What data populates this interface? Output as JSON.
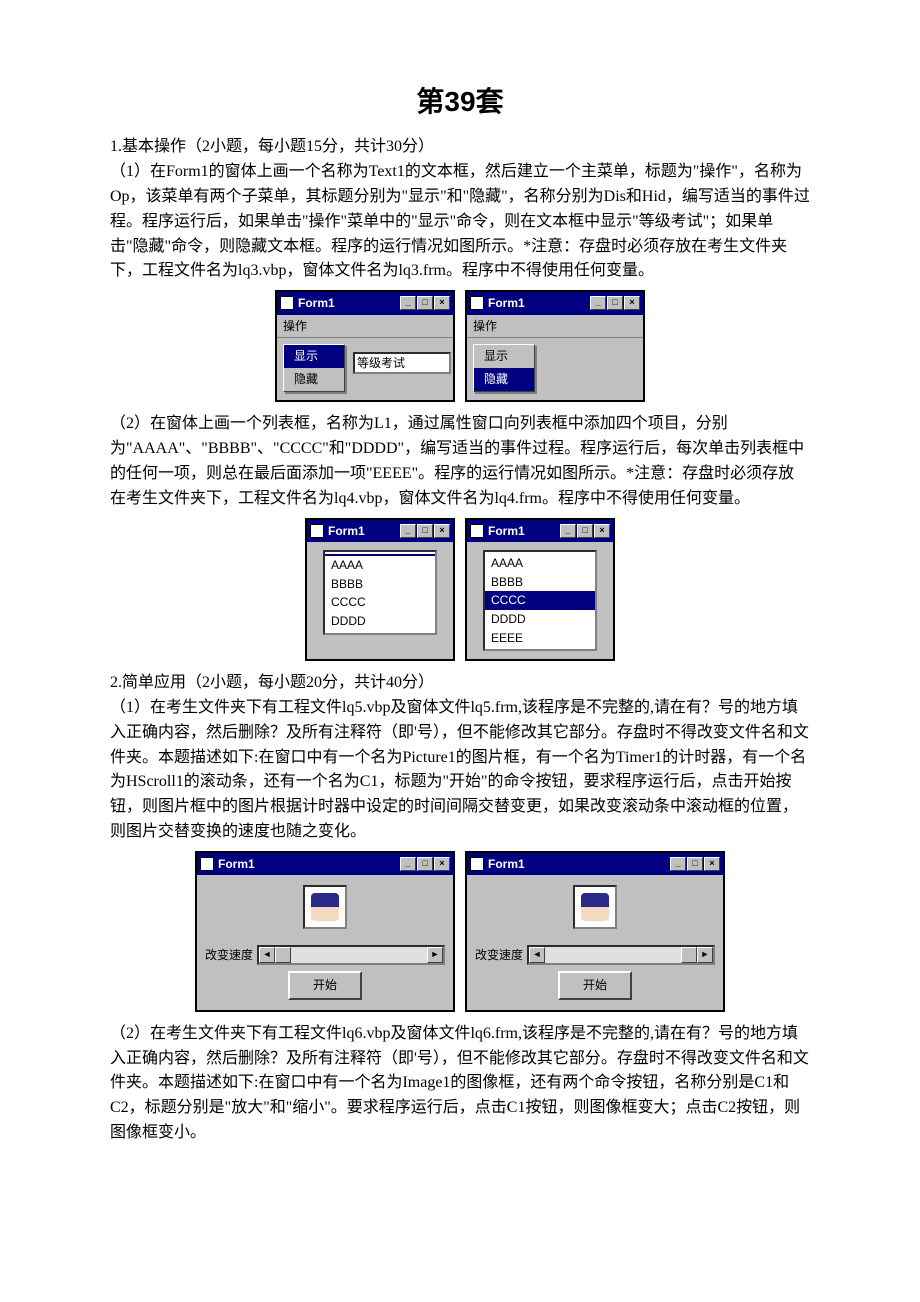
{
  "title": "第39套",
  "s1_heading": "1.基本操作（2小题，每小题15分，共计30分）",
  "s1_q1": "（1）在Form1的窗体上画一个名称为Text1的文本框，然后建立一个主菜单，标题为\"操作\"，名称为Op，该菜单有两个子菜单，其标题分别为\"显示\"和\"隐藏\"，名称分别为Dis和Hid，编写适当的事件过程。程序运行后，如果单击\"操作\"菜单中的\"显示\"命令，则在文本框中显示\"等级考试\"；如果单击\"隐藏\"命令，则隐藏文本框。程序的运行情况如图所示。*注意：存盘时必须存放在考生文件夹下，工程文件名为lq3.vbp，窗体文件名为lq3.frm。程序中不得使用任何变量。",
  "s1_q2": "（2）在窗体上画一个列表框，名称为L1，通过属性窗口向列表框中添加四个项目，分别为\"AAAA\"、\"BBBB\"、\"CCCC\"和\"DDDD\"，编写适当的事件过程。程序运行后，每次单击列表框中的任何一项，则总在最后面添加一项\"EEEE\"。程序的运行情况如图所示。*注意：存盘时必须存放在考生文件夹下，工程文件名为lq4.vbp，窗体文件名为lq4.frm。程序中不得使用任何变量。",
  "s2_heading": "2.简单应用（2小题，每小题20分，共计40分）",
  "s2_q1": "（1）在考生文件夹下有工程文件lq5.vbp及窗体文件lq5.frm,该程序是不完整的,请在有？号的地方填入正确内容，然后删除？及所有注释符（即'号），但不能修改其它部分。存盘时不得改变文件名和文件夹。本题描述如下:在窗口中有一个名为Picture1的图片框，有一个名为Timer1的计时器，有一个名为HScroll1的滚动条，还有一个名为C1，标题为\"开始\"的命令按钮，要求程序运行后，点击开始按钮，则图片框中的图片根据计时器中设定的时间间隔交替变更，如果改变滚动条中滚动框的位置，则图片交替变换的速度也随之变化。",
  "s2_q2": "（2）在考生文件夹下有工程文件lq6.vbp及窗体文件lq6.frm,该程序是不完整的,请在有？号的地方填入正确内容，然后删除？及所有注释符（即'号），但不能修改其它部分。存盘时不得改变文件名和文件夹。本题描述如下:在窗口中有一个名为Image1的图像框，还有两个命令按钮，名称分别是C1和C2，标题分别是\"放大\"和\"缩小\"。要求程序运行后，点击C1按钮，则图像框变大；点击C2按钮，则图像框变小。",
  "form_title": "Form1",
  "menu_op": "操作",
  "menu_show": "显示",
  "menu_hide": "隐藏",
  "text_exam": "等级考试",
  "li_a": "AAAA",
  "li_b": "BBBB",
  "li_c": "CCCC",
  "li_d": "DDDD",
  "li_e": "EEEE",
  "lbl_speed": "改变速度",
  "btn_start": "开始",
  "tb_min": "_",
  "tb_max": "□",
  "tb_close": "×",
  "arr_l": "◄",
  "arr_r": "►"
}
